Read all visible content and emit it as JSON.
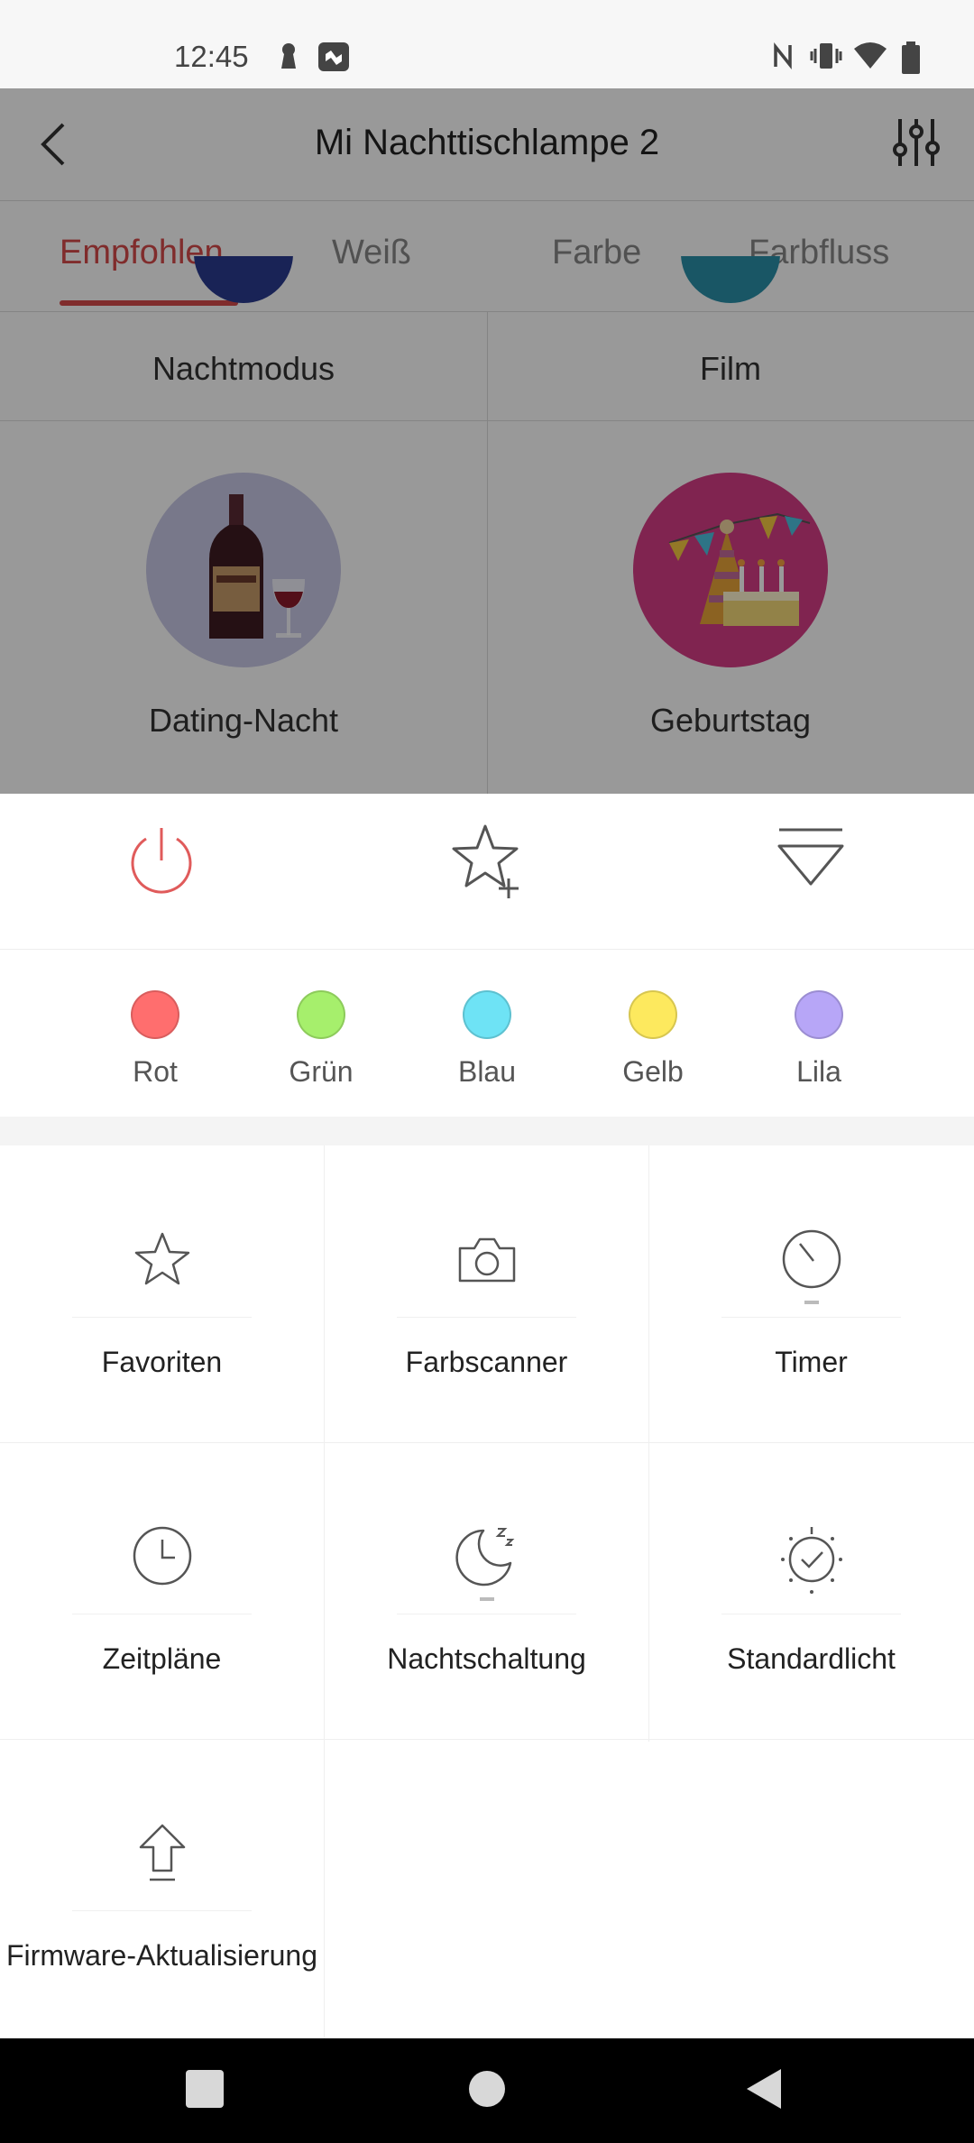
{
  "status_bar": {
    "time": "12:45"
  },
  "header": {
    "title": "Mi Nachttischlampe 2"
  },
  "tabs": [
    {
      "label": "Empfohlen",
      "active": true
    },
    {
      "label": "Weiß"
    },
    {
      "label": "Farbe"
    },
    {
      "label": "Farbfluss"
    }
  ],
  "scenes": [
    {
      "label": "Nachtmodus"
    },
    {
      "label": "Film"
    },
    {
      "label": "Dating-Nacht",
      "icon": "wine-icon"
    },
    {
      "label": "Geburtstag",
      "icon": "party-icon"
    }
  ],
  "actions": {
    "power": "power-icon",
    "favorite_add": "star-plus-icon",
    "collapse": "collapse-icon"
  },
  "colors": [
    {
      "label": "Rot",
      "hex": "#ff6e6e"
    },
    {
      "label": "Grün",
      "hex": "#a6ef6c"
    },
    {
      "label": "Blau",
      "hex": "#6ee3f5"
    },
    {
      "label": "Gelb",
      "hex": "#fde95e"
    },
    {
      "label": "Lila",
      "hex": "#b7a6f7"
    }
  ],
  "grid": [
    {
      "label": "Favoriten",
      "icon": "star-icon"
    },
    {
      "label": "Farbscanner",
      "icon": "camera-icon"
    },
    {
      "label": "Timer",
      "icon": "timer-icon"
    },
    {
      "label": "Zeitpläne",
      "icon": "clock-icon"
    },
    {
      "label": "Nachtschaltung",
      "icon": "moon-icon"
    },
    {
      "label": "Standardlicht",
      "icon": "default-light-icon"
    },
    {
      "label": "Firmware-Aktualisierung",
      "icon": "upload-arrow-icon"
    }
  ],
  "accent_color": "#d54a4a"
}
